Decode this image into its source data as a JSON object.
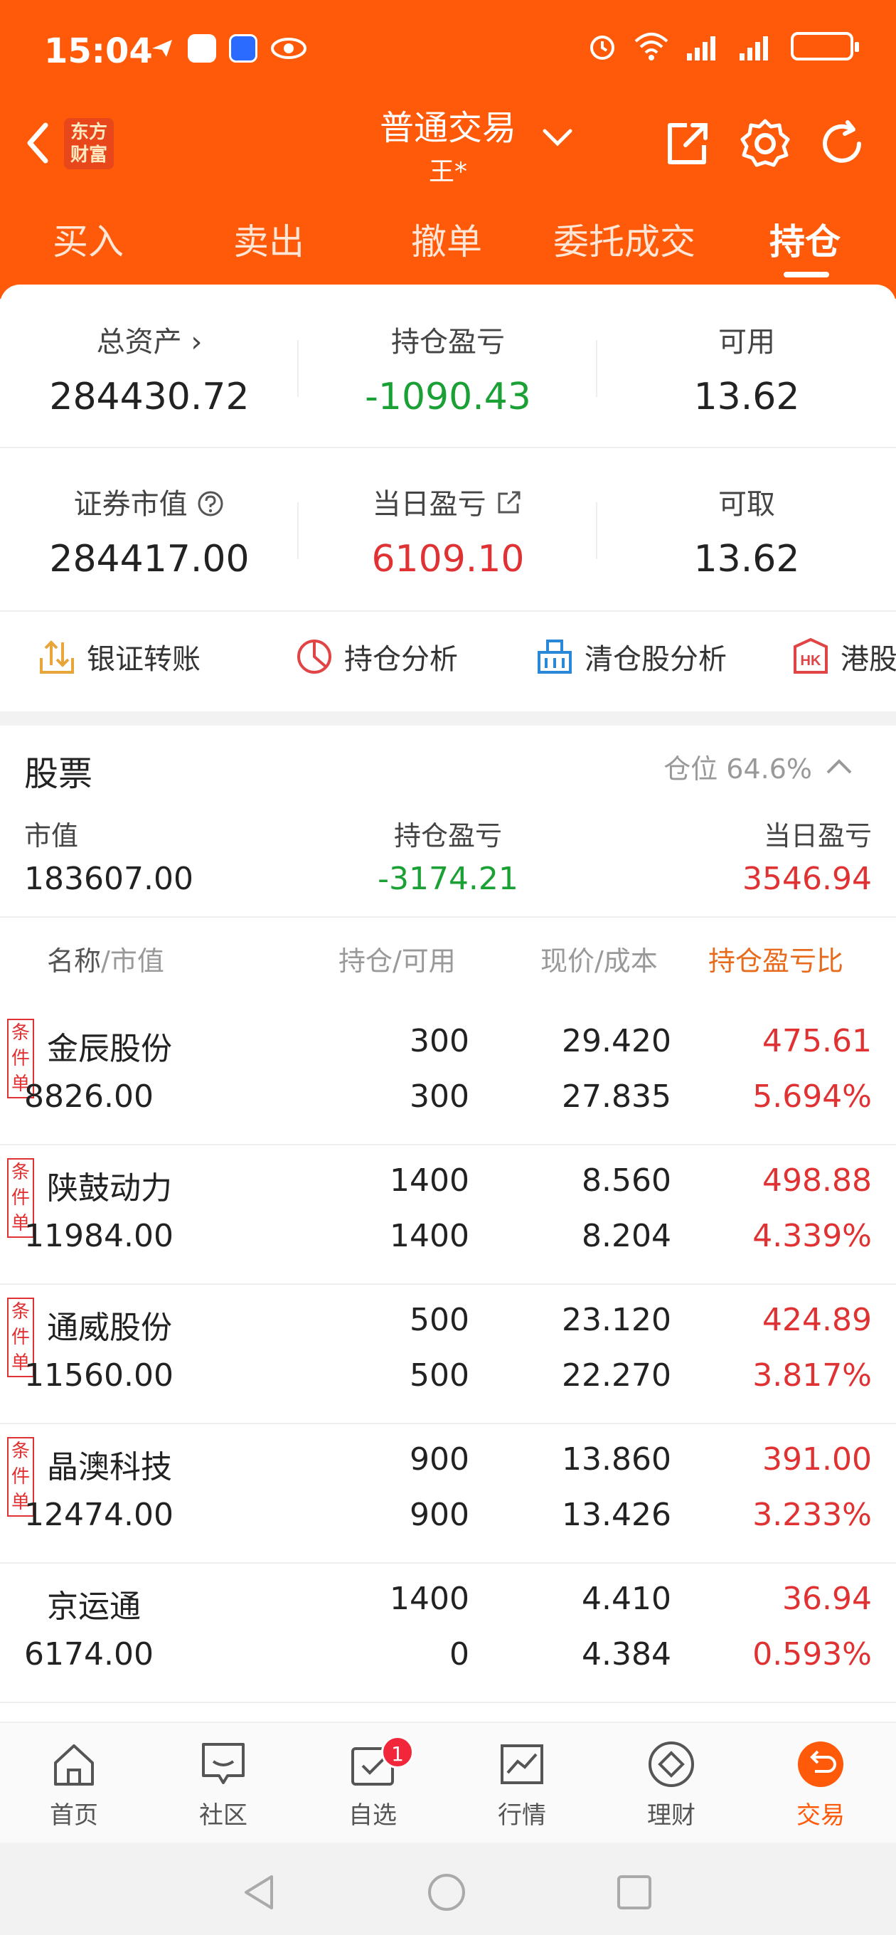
{
  "status": {
    "time": "15:04"
  },
  "header": {
    "logo_text": "东方财富",
    "title": "普通交易",
    "account": "王*",
    "tabs": [
      {
        "label": "买入"
      },
      {
        "label": "卖出"
      },
      {
        "label": "撤单"
      },
      {
        "label": "委托成交"
      },
      {
        "label": "持仓"
      }
    ],
    "active_tab": "持仓"
  },
  "summary": {
    "total_assets_label": "总资产 ›",
    "total_assets": "284430.72",
    "position_pl_label": "持仓盈亏",
    "position_pl": "-1090.43",
    "available_label": "可用",
    "available": "13.62",
    "market_value_label": "证券市值",
    "market_value": "284417.00",
    "daily_pl_label": "当日盈亏",
    "daily_pl": "6109.10",
    "withdrawable_label": "可取",
    "withdrawable": "13.62"
  },
  "shortcuts": [
    {
      "label": "银证转账",
      "icon": "transfer-icon"
    },
    {
      "label": "持仓分析",
      "icon": "pie-chart-icon"
    },
    {
      "label": "清仓股分析",
      "icon": "basket-icon"
    },
    {
      "label": "港股",
      "icon": "hk-icon"
    }
  ],
  "stocks": {
    "title": "股票",
    "position_ratio": "仓位 64.6%",
    "market_value_label": "市值",
    "market_value": "183607.00",
    "position_pl_label": "持仓盈亏",
    "position_pl": "-3174.21",
    "daily_pl_label": "当日盈亏",
    "daily_pl": "3546.94",
    "columns": {
      "name": "名称",
      "name_sub": "/市值",
      "holdings": "持仓/可用",
      "price": "现价/成本",
      "pl_ratio": "持仓盈亏比"
    },
    "condition_label": "条件单",
    "rows": [
      {
        "name": "金辰股份",
        "value": "8826.00",
        "hold": "300",
        "avail": "300",
        "price": "29.420",
        "cost": "27.835",
        "pl": "475.61",
        "ratio": "5.694%",
        "condition": true
      },
      {
        "name": "陕鼓动力",
        "value": "11984.00",
        "hold": "1400",
        "avail": "1400",
        "price": "8.560",
        "cost": "8.204",
        "pl": "498.88",
        "ratio": "4.339%",
        "condition": true
      },
      {
        "name": "通威股份",
        "value": "11560.00",
        "hold": "500",
        "avail": "500",
        "price": "23.120",
        "cost": "22.270",
        "pl": "424.89",
        "ratio": "3.817%",
        "condition": true
      },
      {
        "name": "晶澳科技",
        "value": "12474.00",
        "hold": "900",
        "avail": "900",
        "price": "13.860",
        "cost": "13.426",
        "pl": "391.00",
        "ratio": "3.233%",
        "condition": true
      },
      {
        "name": "京运通",
        "value": "6174.00",
        "hold": "1400",
        "avail": "0",
        "price": "4.410",
        "cost": "4.384",
        "pl": "36.94",
        "ratio": "0.593%",
        "condition": false
      }
    ]
  },
  "nav": [
    {
      "label": "首页",
      "icon": "home-icon"
    },
    {
      "label": "社区",
      "icon": "chat-icon"
    },
    {
      "label": "自选",
      "icon": "checklist-icon",
      "badge": "1"
    },
    {
      "label": "行情",
      "icon": "trend-chart-icon"
    },
    {
      "label": "理财",
      "icon": "diamond-icon"
    },
    {
      "label": "交易",
      "icon": "trade-icon"
    }
  ],
  "colors": {
    "brand": "#ff5a0a",
    "gain": "#e03232",
    "loss": "#1aa034"
  }
}
